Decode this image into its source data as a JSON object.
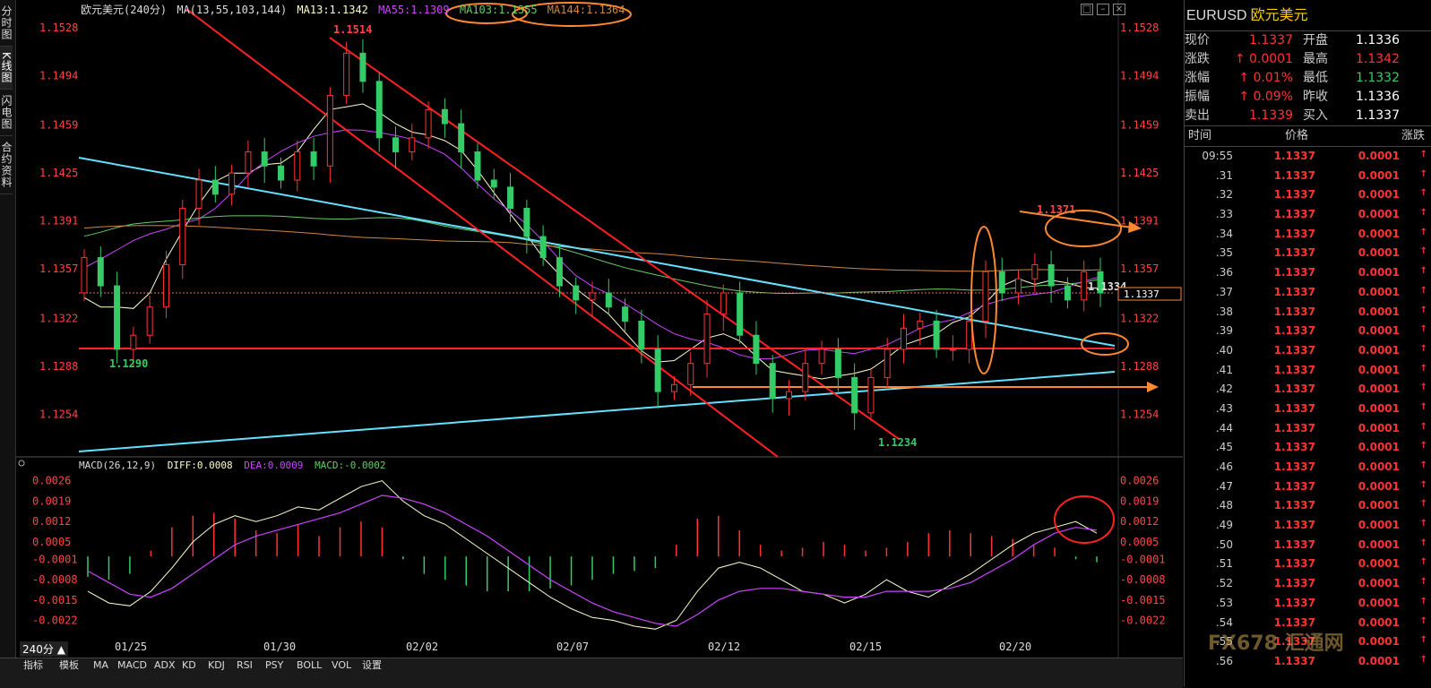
{
  "left_tabs": [
    "分时图",
    "K线图",
    "闪电图",
    "合约资料"
  ],
  "chart_header": {
    "symbol_period": "欧元美元(240分)",
    "ma_params": "MA(13,55,103,144)",
    "ma13": "MA13:1.1342",
    "ma55": "MA55:1.1309",
    "ma103": "MA103:1.1355",
    "ma144": "MA144:1.1364"
  },
  "macd_header": {
    "params": "MACD(26,12,9)",
    "diff": "DIFF:0.0008",
    "dea": "DEA:0.0009",
    "macd": "MACD:-0.0002"
  },
  "period_label": "240分",
  "bottom_tabs": [
    "指标",
    "模板",
    "MA",
    "MACD",
    "ADX",
    "KD",
    "KDJ",
    "RSI",
    "PSY",
    "BOLL",
    "VOL",
    "设置"
  ],
  "colors": {
    "up": "#ff3333",
    "down": "#33cc66",
    "ma13": "#ffffcc",
    "ma55": "#cc44ff",
    "ma103": "#66cc66",
    "ma144": "#cc8844",
    "trendline": "#66e0ff",
    "channel": "#ff2222",
    "annotation": "#ff8833"
  },
  "quote_panel": {
    "code": "EURUSD",
    "name": "欧元美元",
    "rows": [
      {
        "k1": "现价",
        "v1": "1.1337",
        "k2": "开盘",
        "v2": "1.1336"
      },
      {
        "k1": "涨跌",
        "v1": "0.0001",
        "k2": "最高",
        "v2": "1.1342"
      },
      {
        "k1": "涨幅",
        "v1": "0.01%",
        "k2": "最低",
        "v2": "1.1332"
      },
      {
        "k1": "振幅",
        "v1": "0.09%",
        "k2": "昨收",
        "v2": "1.1336"
      },
      {
        "k1": "卖出",
        "v1": "1.1339",
        "k2": "买入",
        "v2": "1.1337"
      }
    ]
  },
  "tick_header": {
    "time": "时间",
    "price": "价格",
    "change": "涨跌"
  },
  "ticks": [
    {
      "t": "09:55",
      "p": "1.1337",
      "c": "0.0001"
    },
    {
      "t": ".31",
      "p": "1.1337",
      "c": "0.0001"
    },
    {
      "t": ".32",
      "p": "1.1337",
      "c": "0.0001"
    },
    {
      "t": ".33",
      "p": "1.1337",
      "c": "0.0001"
    },
    {
      "t": ".34",
      "p": "1.1337",
      "c": "0.0001"
    },
    {
      "t": ".35",
      "p": "1.1337",
      "c": "0.0001"
    },
    {
      "t": ".36",
      "p": "1.1337",
      "c": "0.0001"
    },
    {
      "t": ".37",
      "p": "1.1337",
      "c": "0.0001"
    },
    {
      "t": ".38",
      "p": "1.1337",
      "c": "0.0001"
    },
    {
      "t": ".39",
      "p": "1.1337",
      "c": "0.0001"
    },
    {
      "t": ".40",
      "p": "1.1337",
      "c": "0.0001"
    },
    {
      "t": ".41",
      "p": "1.1337",
      "c": "0.0001"
    },
    {
      "t": ".42",
      "p": "1.1337",
      "c": "0.0001"
    },
    {
      "t": ".43",
      "p": "1.1337",
      "c": "0.0001"
    },
    {
      "t": ".44",
      "p": "1.1337",
      "c": "0.0001"
    },
    {
      "t": ".45",
      "p": "1.1337",
      "c": "0.0001"
    },
    {
      "t": ".46",
      "p": "1.1337",
      "c": "0.0001"
    },
    {
      "t": ".47",
      "p": "1.1337",
      "c": "0.0001"
    },
    {
      "t": ".48",
      "p": "1.1337",
      "c": "0.0001"
    },
    {
      "t": ".49",
      "p": "1.1337",
      "c": "0.0001"
    },
    {
      "t": ".50",
      "p": "1.1337",
      "c": "0.0001"
    },
    {
      "t": ".51",
      "p": "1.1337",
      "c": "0.0001"
    },
    {
      "t": ".52",
      "p": "1.1337",
      "c": "0.0001"
    },
    {
      "t": ".53",
      "p": "1.1337",
      "c": "0.0001"
    },
    {
      "t": ".54",
      "p": "1.1337",
      "c": "0.0001"
    },
    {
      "t": ".55",
      "p": "1.1337",
      "c": "0.0001"
    },
    {
      "t": ".56",
      "p": "1.1337",
      "c": "0.0001"
    }
  ],
  "watermark": "FX678 汇通网",
  "chart_data": [
    {
      "type": "candlestick",
      "title": "欧元美元(240分)",
      "y_ticks": [
        "1.1528",
        "1.1494",
        "1.1459",
        "1.1425",
        "1.1391",
        "1.1357",
        "1.1322",
        "1.1288",
        "1.1254"
      ],
      "ylim": [
        1.1225,
        1.1535
      ],
      "x_ticks": [
        "01/25",
        "01/30",
        "02/02",
        "02/07",
        "02/12",
        "02/15",
        "02/20"
      ],
      "current_price": "1.1337",
      "annotations": [
        "1.1514",
        "1.1290",
        "1.1234",
        "1.1371",
        "1.1334"
      ],
      "candles_close": [
        1.1365,
        1.1345,
        1.13,
        1.131,
        1.133,
        1.136,
        1.14,
        1.142,
        1.141,
        1.1425,
        1.144,
        1.143,
        1.142,
        1.144,
        1.143,
        1.148,
        1.151,
        1.149,
        1.145,
        1.144,
        1.145,
        1.147,
        1.146,
        1.144,
        1.142,
        1.1415,
        1.14,
        1.138,
        1.1365,
        1.1345,
        1.1335,
        1.134,
        1.133,
        1.132,
        1.13,
        1.127,
        1.1275,
        1.129,
        1.1325,
        1.134,
        1.131,
        1.129,
        1.1265,
        1.127,
        1.129,
        1.13,
        1.128,
        1.1255,
        1.128,
        1.13,
        1.1315,
        1.132,
        1.13,
        1.13,
        1.132,
        1.1355,
        1.134,
        1.135,
        1.136,
        1.1345,
        1.1335,
        1.1355,
        1.134
      ]
    },
    {
      "type": "macd",
      "y_ticks": [
        "0.0026",
        "0.0019",
        "0.0012",
        "0.0005",
        "-0.0001",
        "-0.0008",
        "-0.0015",
        "-0.0022"
      ],
      "ylim": [
        -0.0028,
        0.0029
      ],
      "diff": [
        -0.0012,
        -0.0016,
        -0.0017,
        -0.0012,
        -0.0004,
        0.0005,
        0.0011,
        0.0014,
        0.0012,
        0.0014,
        0.0017,
        0.0016,
        0.002,
        0.0024,
        0.0026,
        0.0019,
        0.0014,
        0.0011,
        0.0006,
        0.0001,
        -0.0004,
        -0.0009,
        -0.0014,
        -0.0018,
        -0.0021,
        -0.0022,
        -0.0024,
        -0.0025,
        -0.0022,
        -0.0012,
        -0.0004,
        -0.0002,
        -0.0004,
        -0.0008,
        -0.0012,
        -0.0013,
        -0.0016,
        -0.0013,
        -0.0008,
        -0.0012,
        -0.0014,
        -0.001,
        -0.0006,
        -0.0001,
        0.0004,
        0.0008,
        0.001,
        0.0012,
        0.0008
      ],
      "dea": [
        -0.0005,
        -0.0009,
        -0.0013,
        -0.0014,
        -0.0011,
        -0.0006,
        -0.0001,
        0.0004,
        0.0007,
        0.0009,
        0.0011,
        0.0013,
        0.0015,
        0.0018,
        0.0021,
        0.002,
        0.0018,
        0.0015,
        0.0011,
        0.0007,
        0.0002,
        -0.0003,
        -0.0008,
        -0.0012,
        -0.0016,
        -0.0019,
        -0.0021,
        -0.0023,
        -0.0024,
        -0.002,
        -0.0015,
        -0.0012,
        -0.0011,
        -0.0011,
        -0.0012,
        -0.0013,
        -0.0014,
        -0.0014,
        -0.0012,
        -0.0012,
        -0.0012,
        -0.0011,
        -0.0009,
        -0.0005,
        -0.0001,
        0.0004,
        0.0008,
        0.001,
        0.0009
      ],
      "hist": [
        -0.0007,
        -0.0008,
        -0.0006,
        0.0002,
        0.001,
        0.0014,
        0.0015,
        0.0013,
        0.0009,
        0.0008,
        0.0011,
        0.0007,
        0.001,
        0.0012,
        0.001,
        -0.0001,
        -0.0006,
        -0.0008,
        -0.001,
        -0.0012,
        -0.0012,
        -0.0012,
        -0.0011,
        -0.001,
        -0.0008,
        -0.0006,
        -0.0005,
        -0.0004,
        0.0004,
        0.0013,
        0.0014,
        0.0009,
        0.0004,
        0.0002,
        0.0003,
        0.0005,
        0.0004,
        0.0002,
        0.0003,
        0.0005,
        0.0008,
        0.0009,
        0.0008,
        0.0007,
        0.0006,
        0.0004,
        0.0003,
        -0.0001,
        -0.0002
      ]
    }
  ]
}
